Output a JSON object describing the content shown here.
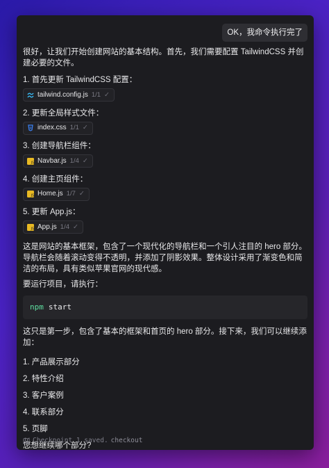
{
  "user_message": "OK，我命令执行完了",
  "intro": "很好，让我们开始创建网站的基本结构。首先，我们需要配置 TailwindCSS 并创建必要的文件。",
  "steps": [
    {
      "title": "1. 首先更新 TailwindCSS 配置：",
      "file": "tailwind.config.js",
      "meta": "1/1",
      "icon": "tailwind-icon"
    },
    {
      "title": "2. 更新全局样式文件：",
      "file": "index.css",
      "meta": "1/1",
      "icon": "css-icon"
    },
    {
      "title": "3. 创建导航栏组件：",
      "file": "Navbar.js",
      "meta": "1/4",
      "icon": "js-icon"
    },
    {
      "title": "4. 创建主页组件：",
      "file": "Home.js",
      "meta": "1/7",
      "icon": "js-icon"
    },
    {
      "title": "5. 更新 App.js：",
      "file": "App.js",
      "meta": "1/4",
      "icon": "js-icon"
    }
  ],
  "description": "这是网站的基本框架，包含了一个现代化的导航栏和一个引人注目的 hero 部分。导航栏会随着滚动变得不透明，并添加了阴影效果。整体设计采用了渐变色和简洁的布局，具有类似苹果官网的现代感。",
  "run_label": "要运行项目，请执行：",
  "code": {
    "cmd": "npm",
    "arg": "start"
  },
  "next_text": "这只是第一步，包含了基本的框架和首页的 hero 部分。接下来，我们可以继续添加：",
  "next_items": [
    "1. 产品展示部分",
    "2. 特性介绍",
    "3. 客户案例",
    "4. 联系部分",
    "5. 页脚"
  ],
  "question": "您想继续哪个部分?",
  "checkpoint": {
    "text": "Checkpoint 1 saved.",
    "link": "checkout"
  },
  "colors": {
    "code_cmd": "#5ee0a0",
    "js_icon": "#e8b923",
    "tailwind_icon": "#38bdf8",
    "css_icon": "#3b82f6"
  }
}
